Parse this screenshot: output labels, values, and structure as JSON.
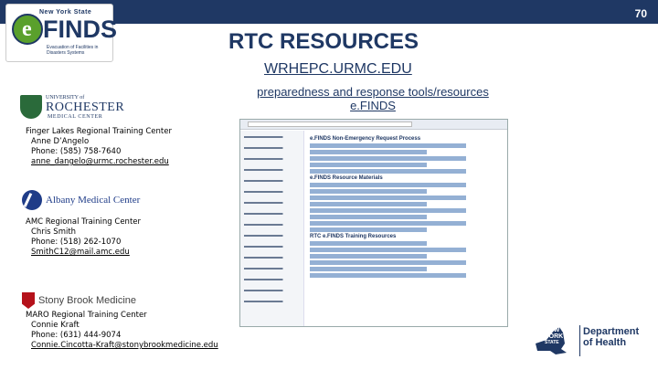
{
  "slide": {
    "number": "70"
  },
  "logo_efinds": {
    "top": "New York State",
    "word": "FINDS",
    "tagline": "Evacuation of Facilities in Disasters Systems"
  },
  "title": "RTC RESOURCES",
  "subtitle": "WRHEPC.URMC.EDU",
  "subtitle2": "preparedness and response tools/resources e.FINDS",
  "contacts": [
    {
      "org": "Finger Lakes Regional Training Center",
      "name": "Anne D’Angelo",
      "phone": "Phone: (585) 758-7640",
      "email": "anne_dangelo@urmc.rochester.edu"
    },
    {
      "org": "AMC Regional Training Center",
      "name": "Chris Smith",
      "phone": "Phone: (518) 262-1070",
      "email": "SmithC12@mail.amc.edu"
    },
    {
      "org": "MARO Regional Training Center",
      "name": "Connie Kraft",
      "phone": "Phone: (631) 444-9074",
      "email": "Connie.Cincotta-Kraft@stonybrookmedicine.edu"
    }
  ],
  "logos": {
    "urmc": {
      "line1": "UNIVERSITY of",
      "line2": "ROCHESTER",
      "line3": "MEDICAL CENTER"
    },
    "amc": "Albany Medical Center",
    "sbm": "Stony Brook Medicine",
    "nys": {
      "line1": "NEW",
      "line2": "YORK",
      "line3": "STATE",
      "dept": "Department of Health"
    }
  },
  "screenshot": {
    "heading1": "e.FINDS Non-Emergency Request Process",
    "heading2": "e.FINDS Resource Materials",
    "heading3": "RTC e.FINDS Training Resources"
  }
}
